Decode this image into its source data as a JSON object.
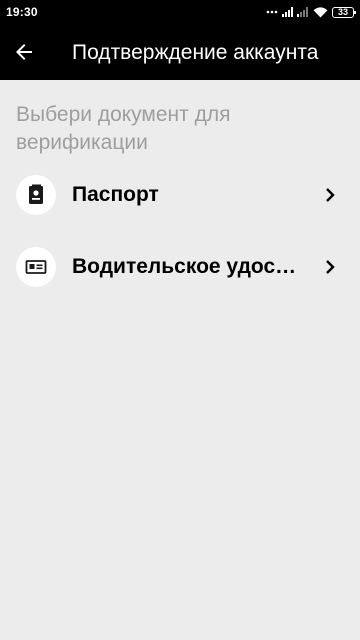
{
  "status_bar": {
    "time": "19:30",
    "battery_level": "33",
    "icons": [
      "dots-icon",
      "signal-icon",
      "signal-icon",
      "wifi-icon",
      "battery-icon"
    ]
  },
  "app_bar": {
    "back_icon": "arrow-back-icon",
    "title": "Подтверждение аккаунта"
  },
  "main": {
    "subtitle": "Выбери документ для верификации",
    "items": [
      {
        "label": "Паспорт",
        "icon": "passport-icon"
      },
      {
        "label": "Водительское удостоверение",
        "icon": "id-card-icon"
      }
    ],
    "chevron_icon": "chevron-right-icon"
  },
  "colors": {
    "app_bar_bg": "#000000",
    "page_bg": "#ececec",
    "subtitle": "#9e9e9e",
    "icon_circle_bg": "#ffffff"
  }
}
